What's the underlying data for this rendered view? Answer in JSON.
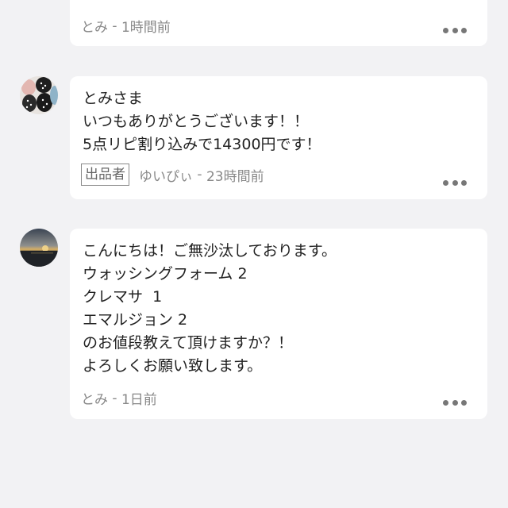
{
  "comments": [
    {
      "author": "とみ",
      "time": "1時間前",
      "lines": []
    },
    {
      "author": "ゆいぴぃ",
      "time": "23時間前",
      "badge": "出品者",
      "lines": [
        "とみさま",
        "いつもありがとうございます！！",
        "5点リピ割り込みで14300円です！"
      ]
    },
    {
      "author": "とみ",
      "time": "1日前",
      "lines": [
        "こんにちは！ご無沙汰しております。",
        "ウォッシングフォーム 2",
        "クレマサ  1",
        "エマルジョン 2",
        "のお値段教えて頂けますか？！",
        "よろしくお願い致します。"
      ]
    }
  ],
  "meta_separator": " - "
}
